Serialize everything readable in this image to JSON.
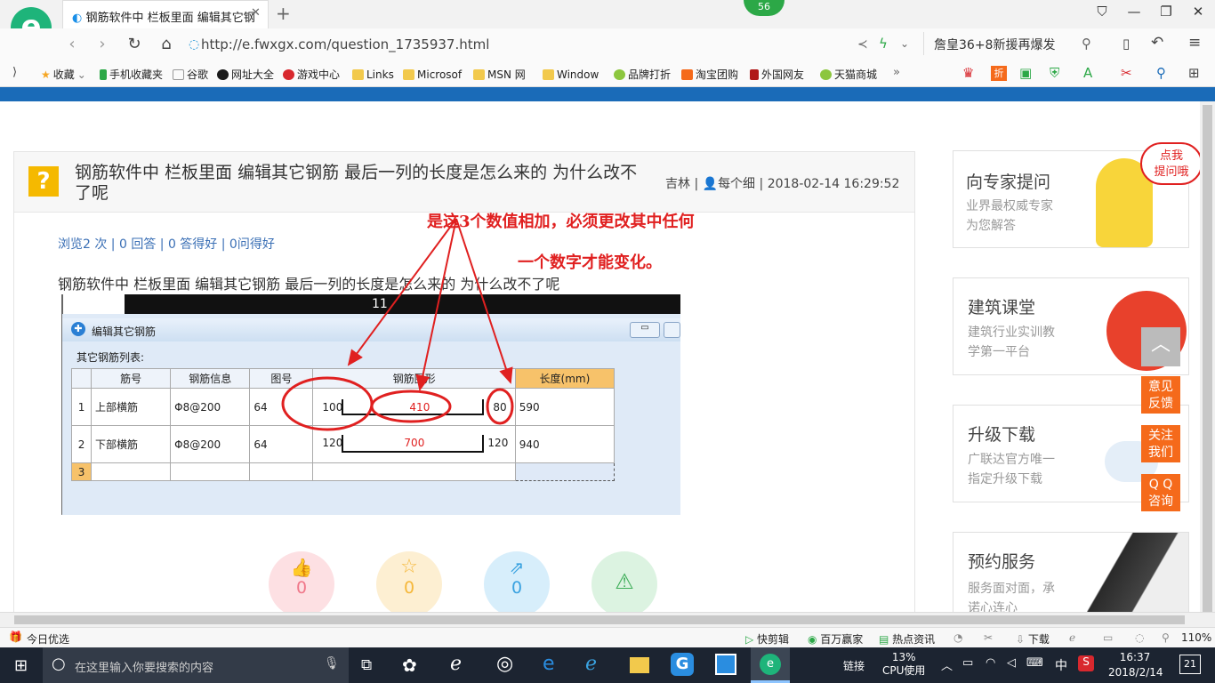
{
  "browser": {
    "tab_title": "钢筋软件中 栏板里面 编辑其它钢",
    "badge": "56",
    "url": "http://e.fwxgx.com/question_1735937.html",
    "search_hint": "詹皇36+8新援再爆发",
    "favorites": [
      "收藏",
      "手机收藏夹",
      "谷歌",
      "网址大全",
      "游戏中心",
      "Links",
      "Microsof",
      "MSN 网",
      "Window",
      "品牌打折",
      "淘宝团购",
      "外国网友",
      "天猫商城"
    ]
  },
  "question": {
    "title": "钢筋软件中 栏板里面 编辑其它钢筋 最后一列的长度是怎么来的 为什么改不了呢",
    "author": "吉林",
    "user": "每个细",
    "time": "2018-02-14 16:29:52",
    "stats": "浏览2 次 | 0 回答 | 0 答得好 | 0问得好",
    "body": "钢筋软件中  栏板里面  编辑其它钢筋 最后一列的长度是怎么来的  为什么改不了呢",
    "annotation_line1": "是这3个数值相加，必须更改其中任何",
    "annotation_line2": "一个数字才能变化。"
  },
  "dialog": {
    "title": "编辑其它钢筋",
    "list_label": "其它钢筋列表:",
    "top_number": "11",
    "headers": [
      "筋号",
      "钢筋信息",
      "图号",
      "钢筋图形",
      "长度(mm)"
    ],
    "rows": [
      {
        "idx": "1",
        "name": "上部横筋",
        "info": "Φ8@200",
        "fig": "64",
        "left": "100",
        "mid": "410",
        "right": "80",
        "len": "590"
      },
      {
        "idx": "2",
        "name": "下部横筋",
        "info": "Φ8@200",
        "fig": "64",
        "left": "120",
        "mid": "700",
        "right": "120",
        "len": "940"
      },
      {
        "idx": "3"
      }
    ]
  },
  "actions": {
    "like": "0",
    "favorite": "0",
    "share": "0"
  },
  "sidebar": {
    "cards": [
      {
        "title": "向专家提问",
        "sub1": "业界最权威专家",
        "sub2": "为您解答"
      },
      {
        "title": "建筑课堂",
        "sub1": "建筑行业实训教",
        "sub2": "学第一平台"
      },
      {
        "title": "升级下载",
        "sub1": "广联达官方唯一",
        "sub2": "指定升级下载"
      },
      {
        "title": "预约服务",
        "sub1": "服务面对面，承",
        "sub2": "诺心连心"
      }
    ],
    "bubble1": "点我",
    "bubble2": "提问哦",
    "float_buttons": [
      [
        "意见",
        "反馈"
      ],
      [
        "关注",
        "我们"
      ],
      [
        "Q Q",
        "咨询"
      ]
    ]
  },
  "statusbar": {
    "left": "今日优选",
    "items": [
      "快剪辑",
      "百万赢家",
      "热点资讯",
      "下载"
    ],
    "zoom": "110%"
  },
  "taskbar": {
    "search_placeholder": "在这里输入你要搜索的内容",
    "links": "链接",
    "cpu_pct": "13%",
    "cpu_label": "CPU使用",
    "ime": "中",
    "time": "16:37",
    "date": "2018/2/14",
    "notif": "21"
  },
  "colors": {
    "accent_blue": "#1a6bb8",
    "annotation_red": "#e02020",
    "float_orange": "#f56a1b",
    "question_yellow": "#f5b900"
  }
}
